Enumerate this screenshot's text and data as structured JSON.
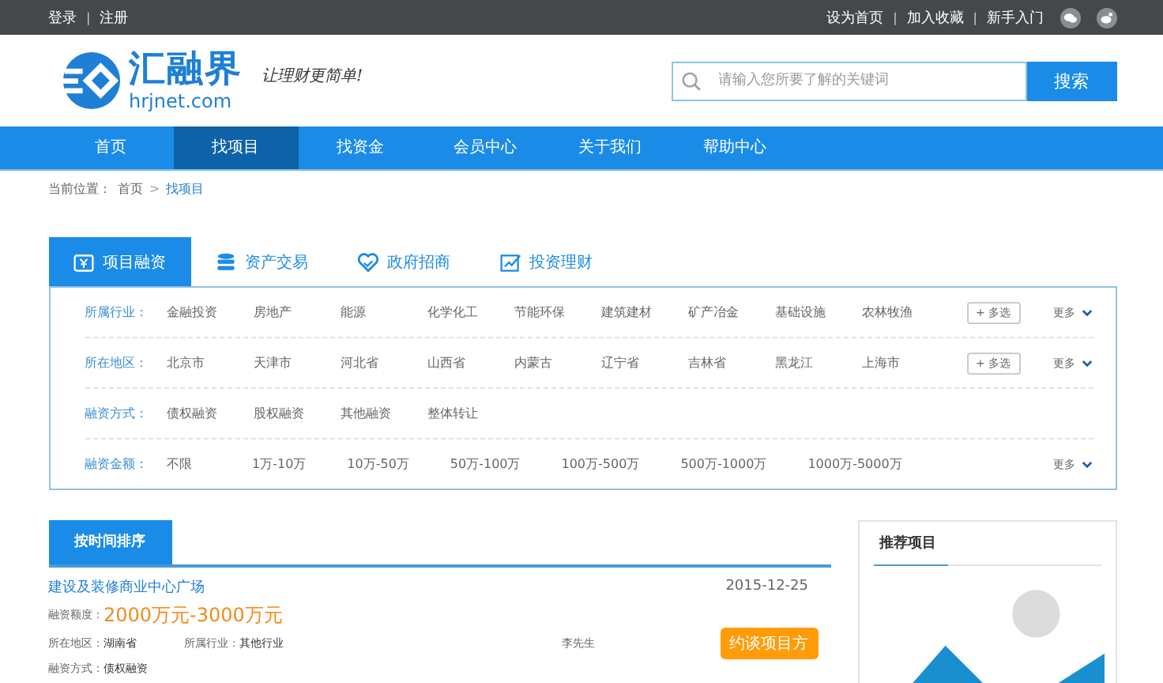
{
  "topbar": {
    "left_links": [
      "登录",
      "注册"
    ],
    "right_links": [
      "设为首页",
      "加入收藏",
      "新手入门"
    ],
    "separator": "|"
  },
  "logo": {
    "name": "汇融界",
    "domain": "hrjnet.com",
    "slogan": "让理财更简单!"
  },
  "search": {
    "placeholder": "请输入您所要了解的关键词",
    "button": "搜索"
  },
  "nav": [
    {
      "label": "首页",
      "selected": false
    },
    {
      "label": "找项目",
      "selected": true
    },
    {
      "label": "找资金",
      "selected": false
    },
    {
      "label": "会员中心",
      "selected": false
    },
    {
      "label": "关于我们",
      "selected": false
    },
    {
      "label": "帮助中心",
      "selected": false
    }
  ],
  "breadcrumb": {
    "prefix": "当前位置：",
    "items": [
      "首页",
      "找项目"
    ],
    "separator": ">"
  },
  "tabs": [
    {
      "label": "项目融资",
      "kind": "yen",
      "selected": true
    },
    {
      "label": "资产交易",
      "kind": "stack",
      "selected": false
    },
    {
      "label": "政府招商",
      "kind": "heart",
      "selected": false
    },
    {
      "label": "投资理财",
      "kind": "chart",
      "selected": false
    }
  ],
  "filters": [
    {
      "label": "所属行业：",
      "options": [
        "金融投资",
        "房地产",
        "能源",
        "化学化工",
        "节能环保",
        "建筑建材",
        "矿产冶金",
        "基础设施",
        "农林牧渔"
      ],
      "multi": "+ 多选",
      "more": "更多"
    },
    {
      "label": "所在地区：",
      "options": [
        "北京市",
        "天津市",
        "河北省",
        "山西省",
        "内蒙古",
        "辽宁省",
        "吉林省",
        "黑龙江",
        "上海市"
      ],
      "multi": "+ 多选",
      "more": "更多"
    },
    {
      "label": "融资方式：",
      "options": [
        "债权融资",
        "股权融资",
        "其他融资",
        "整体转让"
      ]
    },
    {
      "label": "融资金额：",
      "options": [
        "不限",
        "1万-10万",
        "10万-50万",
        "50万-100万",
        "100万-500万",
        "500万-1000万",
        "1000万-5000万"
      ],
      "more": "更多"
    }
  ],
  "sort_tab": "按时间排序",
  "projects": [
    {
      "title": "建设及装修商业中心广场",
      "date": "2015-12-25",
      "amount_label": "融资额度：",
      "amount": "2000万元-3000万元",
      "region_label": "所在地区：",
      "region": "湖南省",
      "industry_label": "所属行业：",
      "industry": "其他行业",
      "contact": "李先生",
      "button": "约谈项目方",
      "method_label": "融资方式：",
      "method": "债权融资"
    }
  ],
  "sidebar": {
    "title": "推荐项目"
  }
}
